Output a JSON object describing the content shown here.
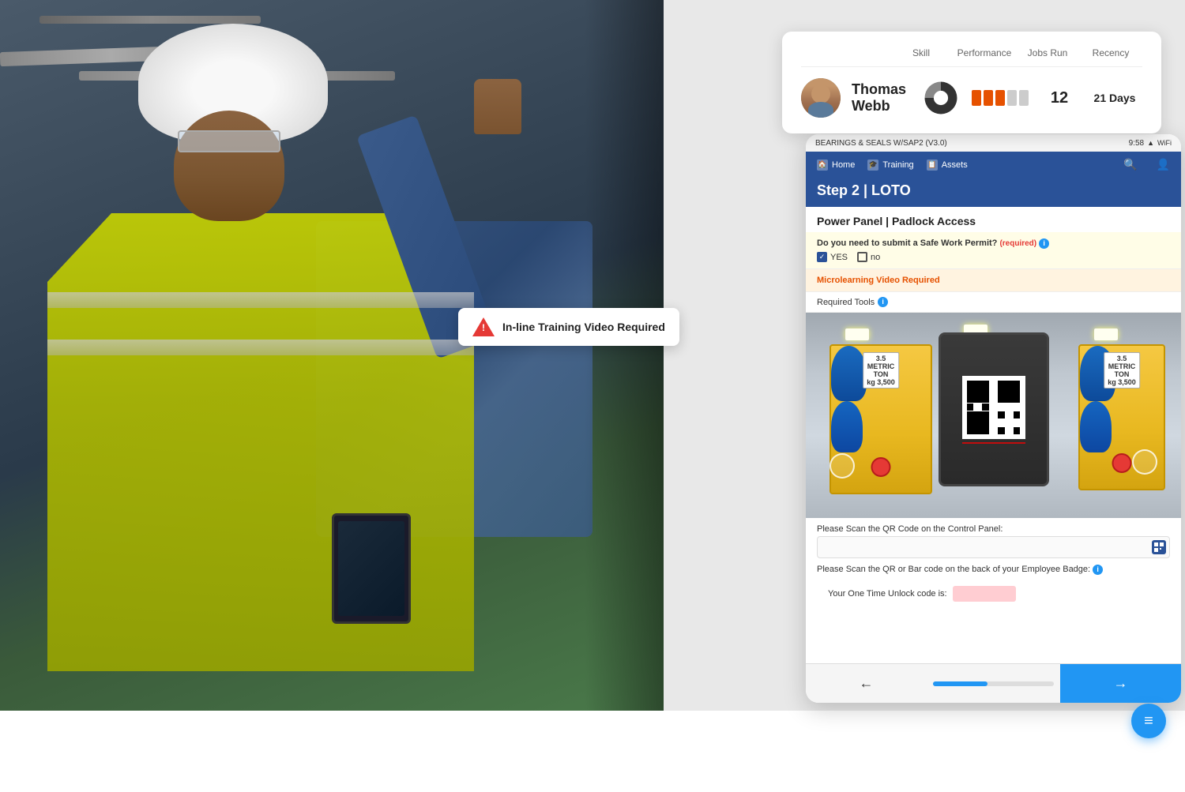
{
  "worker_card": {
    "name": "Thomas Webb",
    "skill_label": "Skill",
    "performance_label": "Performance",
    "jobs_run_label": "Jobs Run",
    "recency_label": "Recency",
    "jobs_run_value": "12",
    "recency_value": "21 Days",
    "performance_bars": [
      {
        "color": "#e65100",
        "filled": true
      },
      {
        "color": "#e65100",
        "filled": true
      },
      {
        "color": "#e65100",
        "filled": true
      },
      {
        "color": "#bbb",
        "filled": false
      },
      {
        "color": "#bbb",
        "filled": false
      }
    ]
  },
  "mobile_app": {
    "status_bar": {
      "app_name": "BEARINGS & SEALS W/SAP2 (V3.0)",
      "time": "9:58",
      "signal": "▲",
      "wifi": "WiFi"
    },
    "nav": {
      "home_label": "Home",
      "training_label": "Training",
      "assets_label": "Assets"
    },
    "step_title": "Step 2 | LOTO",
    "section_title": "Power Panel | Padlock Access",
    "question_label": "Do you need to submit a Safe Work Permit?",
    "required_label": "(required)",
    "yes_label": "YES",
    "no_label": "no",
    "microlearning_label": "Microlearning Video Required",
    "tools_label": "Required Tools",
    "scan_qr_label": "Please Scan the QR Code on the Control Panel:",
    "scan_badge_label": "Please Scan the QR or Bar code on the back of your Employee Badge:",
    "unlock_label": "Your One Time Unlock code is:",
    "progress_percent": 45,
    "back_arrow": "←",
    "forward_arrow": "→"
  },
  "floating_alert": {
    "text": "In-line Training Video Required"
  },
  "fab": {
    "icon": "≡"
  }
}
